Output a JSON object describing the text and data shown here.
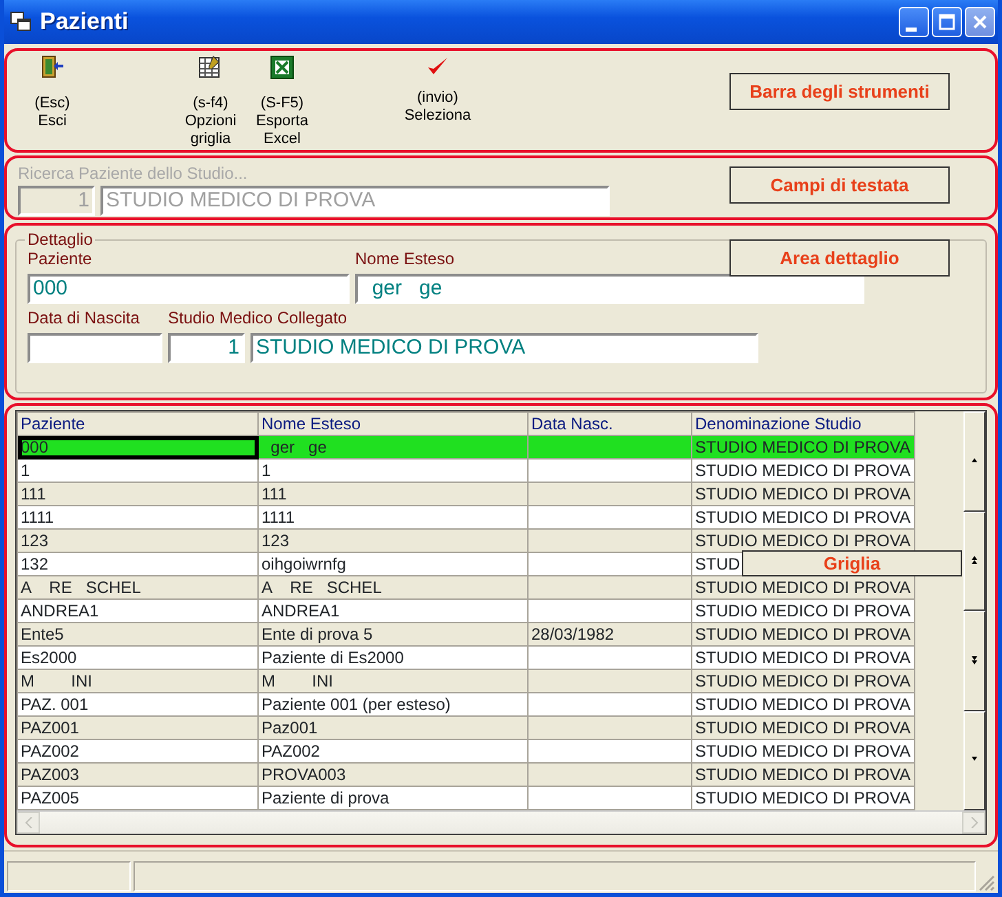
{
  "window": {
    "title": "Pazienti"
  },
  "toolbar": {
    "buttons": [
      {
        "shortcut": "(Esc)",
        "label": "Esci"
      },
      {
        "shortcut": "(s-f4)",
        "label": "Opzioni griglia"
      },
      {
        "shortcut": "(S-F5)",
        "label": "Esporta Excel"
      },
      {
        "shortcut": "(invio)",
        "label": "Seleziona"
      }
    ],
    "callout": "Barra degli strumenti"
  },
  "header_fields": {
    "label": "Ricerca Paziente dello Studio...",
    "disabled": true,
    "code": "1",
    "value": "STUDIO MEDICO DI PROVA",
    "callout": "Campi di testata"
  },
  "detail": {
    "legend": "Dettaglio",
    "callout": "Area dettaglio",
    "rows": [
      [
        {
          "label": "Paziente",
          "inputs": [
            {
              "kind": "text",
              "value": "000"
            }
          ]
        },
        {
          "label": "Nome Esteso",
          "inputs": [
            {
              "kind": "long",
              "value": "  ger   ge"
            }
          ]
        }
      ],
      [
        {
          "label": "Data di Nascita",
          "inputs": [
            {
              "kind": "date"
            }
          ]
        },
        {
          "label": "Studio Medico Collegato",
          "inputs": [
            {
              "kind": "code",
              "value": "1"
            },
            {
              "kind": "name",
              "value": "STUDIO MEDICO DI PROVA"
            }
          ]
        }
      ]
    ]
  },
  "grid": {
    "callout": "Griglia",
    "columns": [
      "Paziente",
      "Nome Esteso",
      "Data Nasc.",
      "Denominazione Studio"
    ],
    "rows": [
      {
        "selected": true,
        "cells": [
          "000",
          "  ger   ge",
          "",
          "STUDIO MEDICO DI PROVA"
        ]
      },
      {
        "selected": false,
        "cells": [
          "1",
          "1",
          "",
          "STUDIO MEDICO DI PROVA"
        ]
      },
      {
        "selected": false,
        "cells": [
          "111",
          "111",
          "",
          "STUDIO MEDICO DI PROVA"
        ]
      },
      {
        "selected": false,
        "cells": [
          "1111",
          "1111",
          "",
          "STUDIO MEDICO DI PROVA"
        ]
      },
      {
        "selected": false,
        "cells": [
          "123",
          "123",
          "",
          "STUDIO MEDICO DI PROVA"
        ]
      },
      {
        "selected": false,
        "cells": [
          "132",
          "oihgoiwrnfg",
          "",
          "STUD"
        ]
      },
      {
        "selected": false,
        "cells": [
          "A    RE   SCHEL",
          "A    RE   SCHEL",
          "",
          "STUDIO MEDICO DI PROVA"
        ]
      },
      {
        "selected": false,
        "cells": [
          "ANDREA1",
          "ANDREA1",
          "",
          "STUDIO MEDICO DI PROVA"
        ]
      },
      {
        "selected": false,
        "cells": [
          "Ente5",
          "Ente di prova 5",
          "28/03/1982",
          "STUDIO MEDICO DI PROVA"
        ]
      },
      {
        "selected": false,
        "cells": [
          "Es2000",
          "Paziente di Es2000",
          "",
          "STUDIO MEDICO DI PROVA"
        ]
      },
      {
        "selected": false,
        "cells": [
          "M        INI",
          "M        INI",
          "",
          "STUDIO MEDICO DI PROVA"
        ]
      },
      {
        "selected": false,
        "cells": [
          "PAZ. 001",
          "Paziente 001 (per esteso)",
          "",
          "STUDIO MEDICO DI PROVA"
        ]
      },
      {
        "selected": false,
        "cells": [
          "PAZ001",
          "Paz001",
          "",
          "STUDIO MEDICO DI PROVA"
        ]
      },
      {
        "selected": false,
        "cells": [
          "PAZ002",
          "PAZ002",
          "",
          "STUDIO MEDICO DI PROVA"
        ]
      },
      {
        "selected": false,
        "cells": [
          "PAZ003",
          "PROVA003",
          "",
          "STUDIO MEDICO DI PROVA"
        ]
      },
      {
        "selected": false,
        "cells": [
          "PAZ005",
          "Paziente di prova",
          "",
          "STUDIO MEDICO DI PROVA"
        ]
      }
    ]
  }
}
